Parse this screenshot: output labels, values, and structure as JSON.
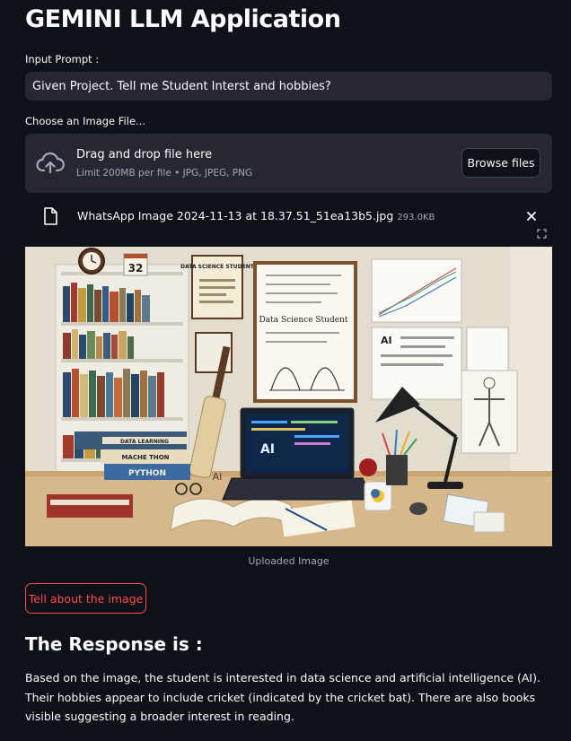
{
  "app": {
    "title": "GEMINI LLM Application"
  },
  "prompt": {
    "label": "Input Prompt :",
    "value": "Given Project. Tell me Student Interst and hobbies?"
  },
  "uploader": {
    "label": "Choose an Image File...",
    "drop_title": "Drag and drop file here",
    "limit_text": "Limit 200MB per file • JPG, JPEG, PNG",
    "browse_label": "Browse files",
    "upload_icon": "cloud-upload-icon"
  },
  "uploaded_file": {
    "name": "WhatsApp Image 2024-11-13 at 18.37.51_51ea13b5.jpg",
    "size": "293.0KB",
    "file_icon": "file-icon",
    "remove_icon": "close-icon"
  },
  "image": {
    "caption": "Uploaded Image",
    "wall_texts": {
      "calendar": "32",
      "poster_title": "DATA SCIENCE STUDENT",
      "board_title": "Data Science Student",
      "ai_note": "AI",
      "laptop_ai": "AI",
      "bat_ai": "AI",
      "book_1": "DATA LEARNING",
      "book_2": "MACHE THON",
      "book_3": "PYTHON"
    }
  },
  "action": {
    "button_label": "Tell about the image"
  },
  "response": {
    "heading": "The Response is :",
    "text": "Based on the image, the student is interested in data science and artificial intelligence (AI). Their hobbies appear to include cricket (indicated by the cricket bat). There are also books visible suggesting a broader interest in reading."
  },
  "colors": {
    "background": "#0e1117",
    "surface": "#262730",
    "accent": "#ff4b4b",
    "muted_text": "#a3a8b8"
  }
}
